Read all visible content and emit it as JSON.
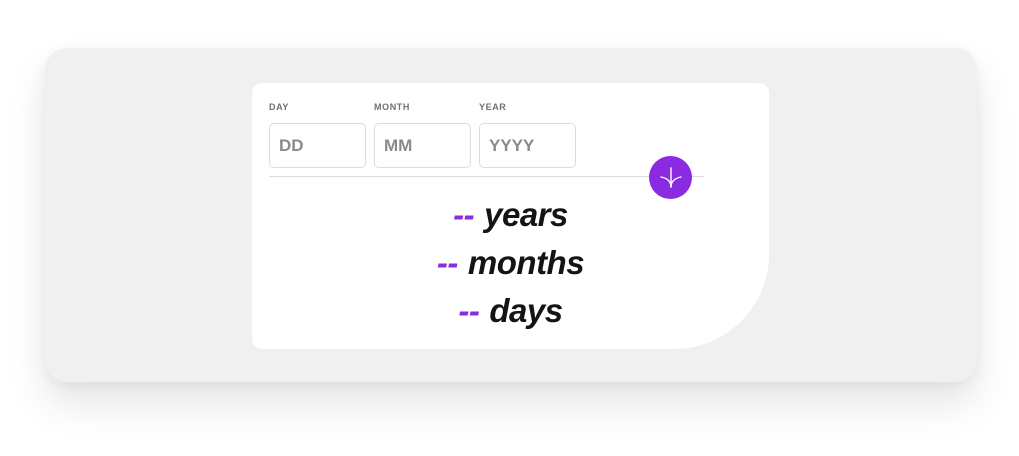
{
  "form": {
    "day": {
      "label": "DAY",
      "placeholder": "DD",
      "value": ""
    },
    "month": {
      "label": "MONTH",
      "placeholder": "MM",
      "value": ""
    },
    "year": {
      "label": "YEAR",
      "placeholder": "YYYY",
      "value": ""
    }
  },
  "submit_icon": "arrow-down-icon",
  "results": [
    {
      "value": "--",
      "unit": "years"
    },
    {
      "value": "--",
      "unit": "months"
    },
    {
      "value": "--",
      "unit": "days"
    }
  ],
  "colors": {
    "accent": "#8a2be2",
    "background": "#f0f0f0",
    "card": "#ffffff",
    "text": "#141414",
    "label": "#716f6f",
    "border": "#dcdcdc"
  }
}
